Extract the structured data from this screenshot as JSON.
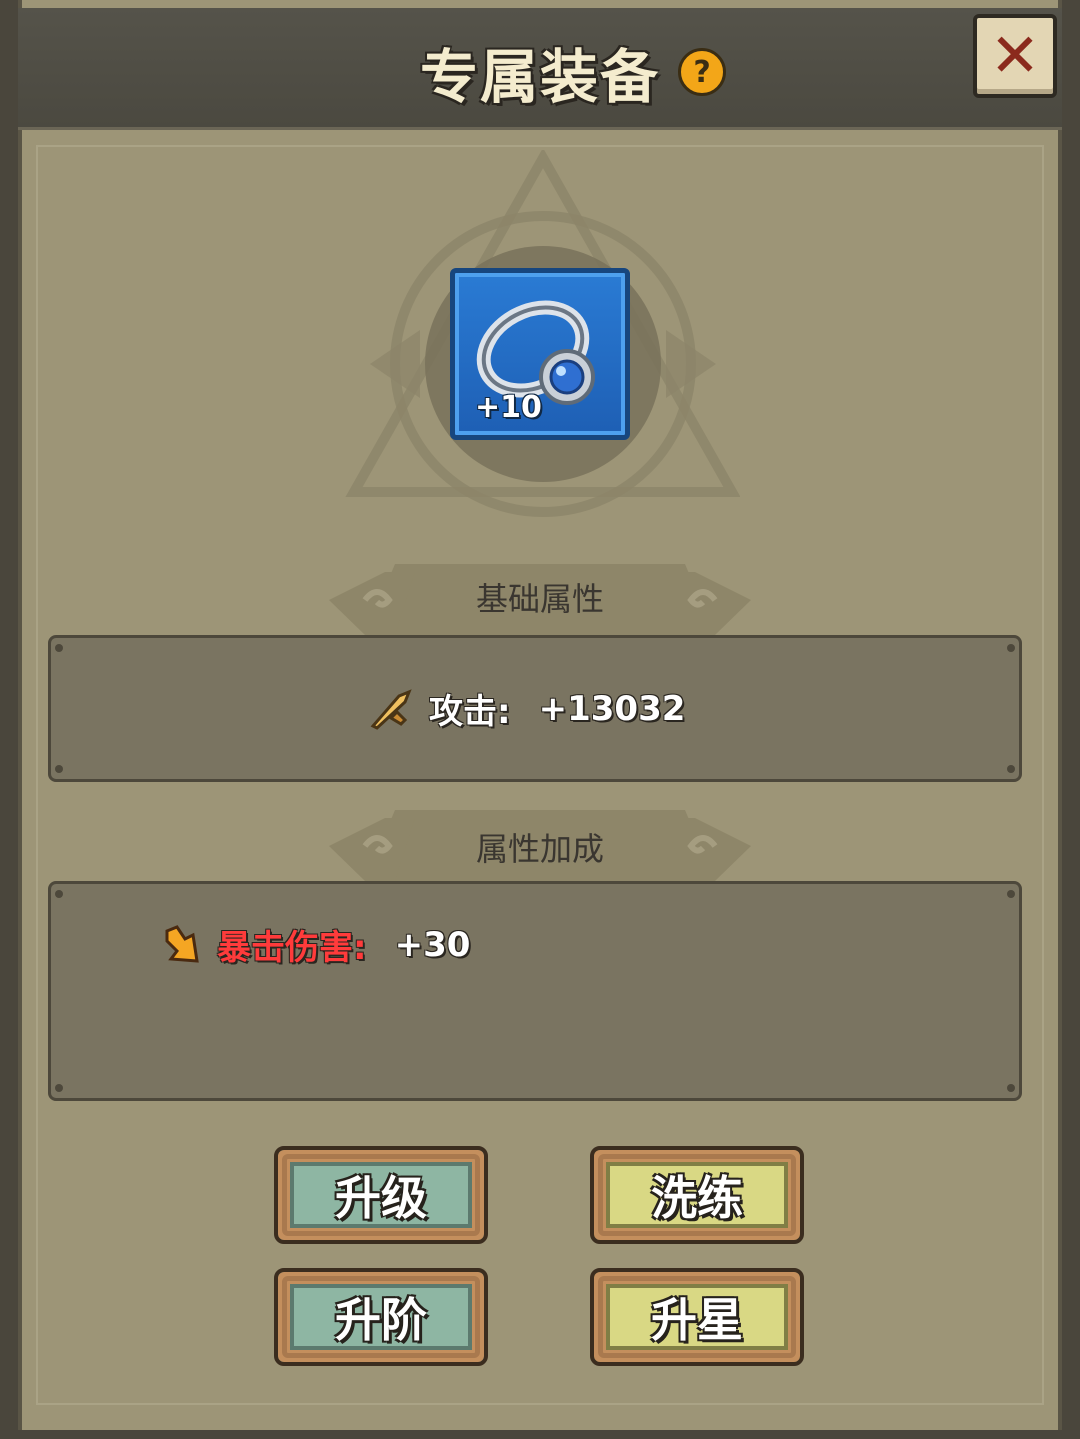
{
  "header": {
    "title": "专属装备",
    "help_icon": "?",
    "close_icon": "✕"
  },
  "item": {
    "icon": "ring-icon",
    "level": "+10"
  },
  "base_attributes": {
    "title": "基础属性",
    "stats": [
      {
        "icon": "sword-icon",
        "label": "攻击:",
        "value": "+13032"
      }
    ]
  },
  "bonus_attributes": {
    "title": "属性加成",
    "stats": [
      {
        "icon": "crit-arrow-icon",
        "label": "暴击伤害:",
        "value": "+30"
      }
    ]
  },
  "buttons": {
    "upgrade": "升级",
    "refine": "洗练",
    "advance": "升阶",
    "star_up": "升星"
  },
  "colors": {
    "panel_bg": "#9d9577",
    "item_bg": "#2a7bd4",
    "crit_label": "#ff3b3b",
    "teal_button": "#8eb6a3",
    "olive_button": "#d9d884"
  }
}
